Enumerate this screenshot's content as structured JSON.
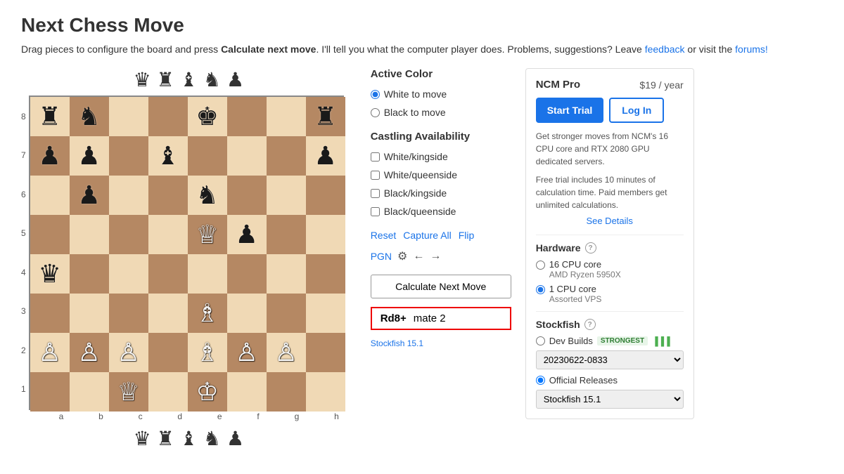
{
  "page": {
    "title": "Next Chess Move",
    "subtitle_pre": "Drag pieces to configure the board and press ",
    "subtitle_bold": "Calculate next move",
    "subtitle_post": ". I'll tell you what the computer player does. Problems, suggestions? Leave ",
    "feedback_link": "feedback",
    "or_visit": " or visit the ",
    "forums_link": "forums!"
  },
  "piece_tray_top": [
    "♛",
    "♜",
    "♝",
    "♞",
    "♟"
  ],
  "piece_tray_bottom": [
    "♛",
    "♜",
    "♝",
    "♞",
    "♟"
  ],
  "board": {
    "ranks": [
      "8",
      "7",
      "6",
      "5",
      "4",
      "3",
      "2",
      "1"
    ],
    "files": [
      "a",
      "b",
      "c",
      "d",
      "e",
      "f",
      "g",
      "h"
    ],
    "pieces": {
      "a8": "♜",
      "b8": "♞",
      "e8": "♚",
      "h8": "♜",
      "a7": "♟",
      "b7": "♟",
      "d7": "♝",
      "h7": "♟",
      "b6": "♟",
      "e6": "♞",
      "e5": "♕",
      "f5": "♟",
      "a4": "♛",
      "e3": "♗",
      "e2_white": "",
      "a2": "♙",
      "b2": "♙",
      "c2": "♙",
      "f2": "♙",
      "g2": "♙",
      "c1": "♕",
      "e1": "♔"
    }
  },
  "controls": {
    "active_color_label": "Active Color",
    "white_to_move": "White to move",
    "black_to_move": "Black to move",
    "white_selected": true,
    "castling_label": "Castling Availability",
    "castling_options": [
      "White/kingside",
      "White/queenside",
      "Black/kingside",
      "Black/queenside"
    ],
    "actions": {
      "reset": "Reset",
      "capture_all": "Capture All",
      "flip": "Flip",
      "pgn": "PGN"
    },
    "calc_button": "Calculate Next Move",
    "result_move": "Rd8+",
    "result_mate": "mate 2",
    "stockfish_version": "Stockfish 15.1"
  },
  "pro_panel": {
    "title": "NCM Pro",
    "price": "$19 / year",
    "start_trial": "Start Trial",
    "log_in": "Log In",
    "desc": "Get stronger moves from NCM's 16 CPU core and RTX 2080 GPU dedicated servers.",
    "trial_desc": "Free trial includes 10 minutes of calculation time. Paid members get unlimited calculations.",
    "see_details": "See Details",
    "hardware_title": "Hardware",
    "hardware_options": [
      {
        "label": "16 CPU core",
        "sublabel": "AMD Ryzen 5950X",
        "selected": false
      },
      {
        "label": "1 CPU core",
        "sublabel": "Assorted VPS",
        "selected": true
      }
    ],
    "stockfish_title": "Stockfish",
    "dev_builds_label": "Dev Builds",
    "strongest_tag": "STRONGEST",
    "dev_version": "20230622-0833",
    "official_label": "Official Releases",
    "official_version": "Stockfish 15.1"
  }
}
